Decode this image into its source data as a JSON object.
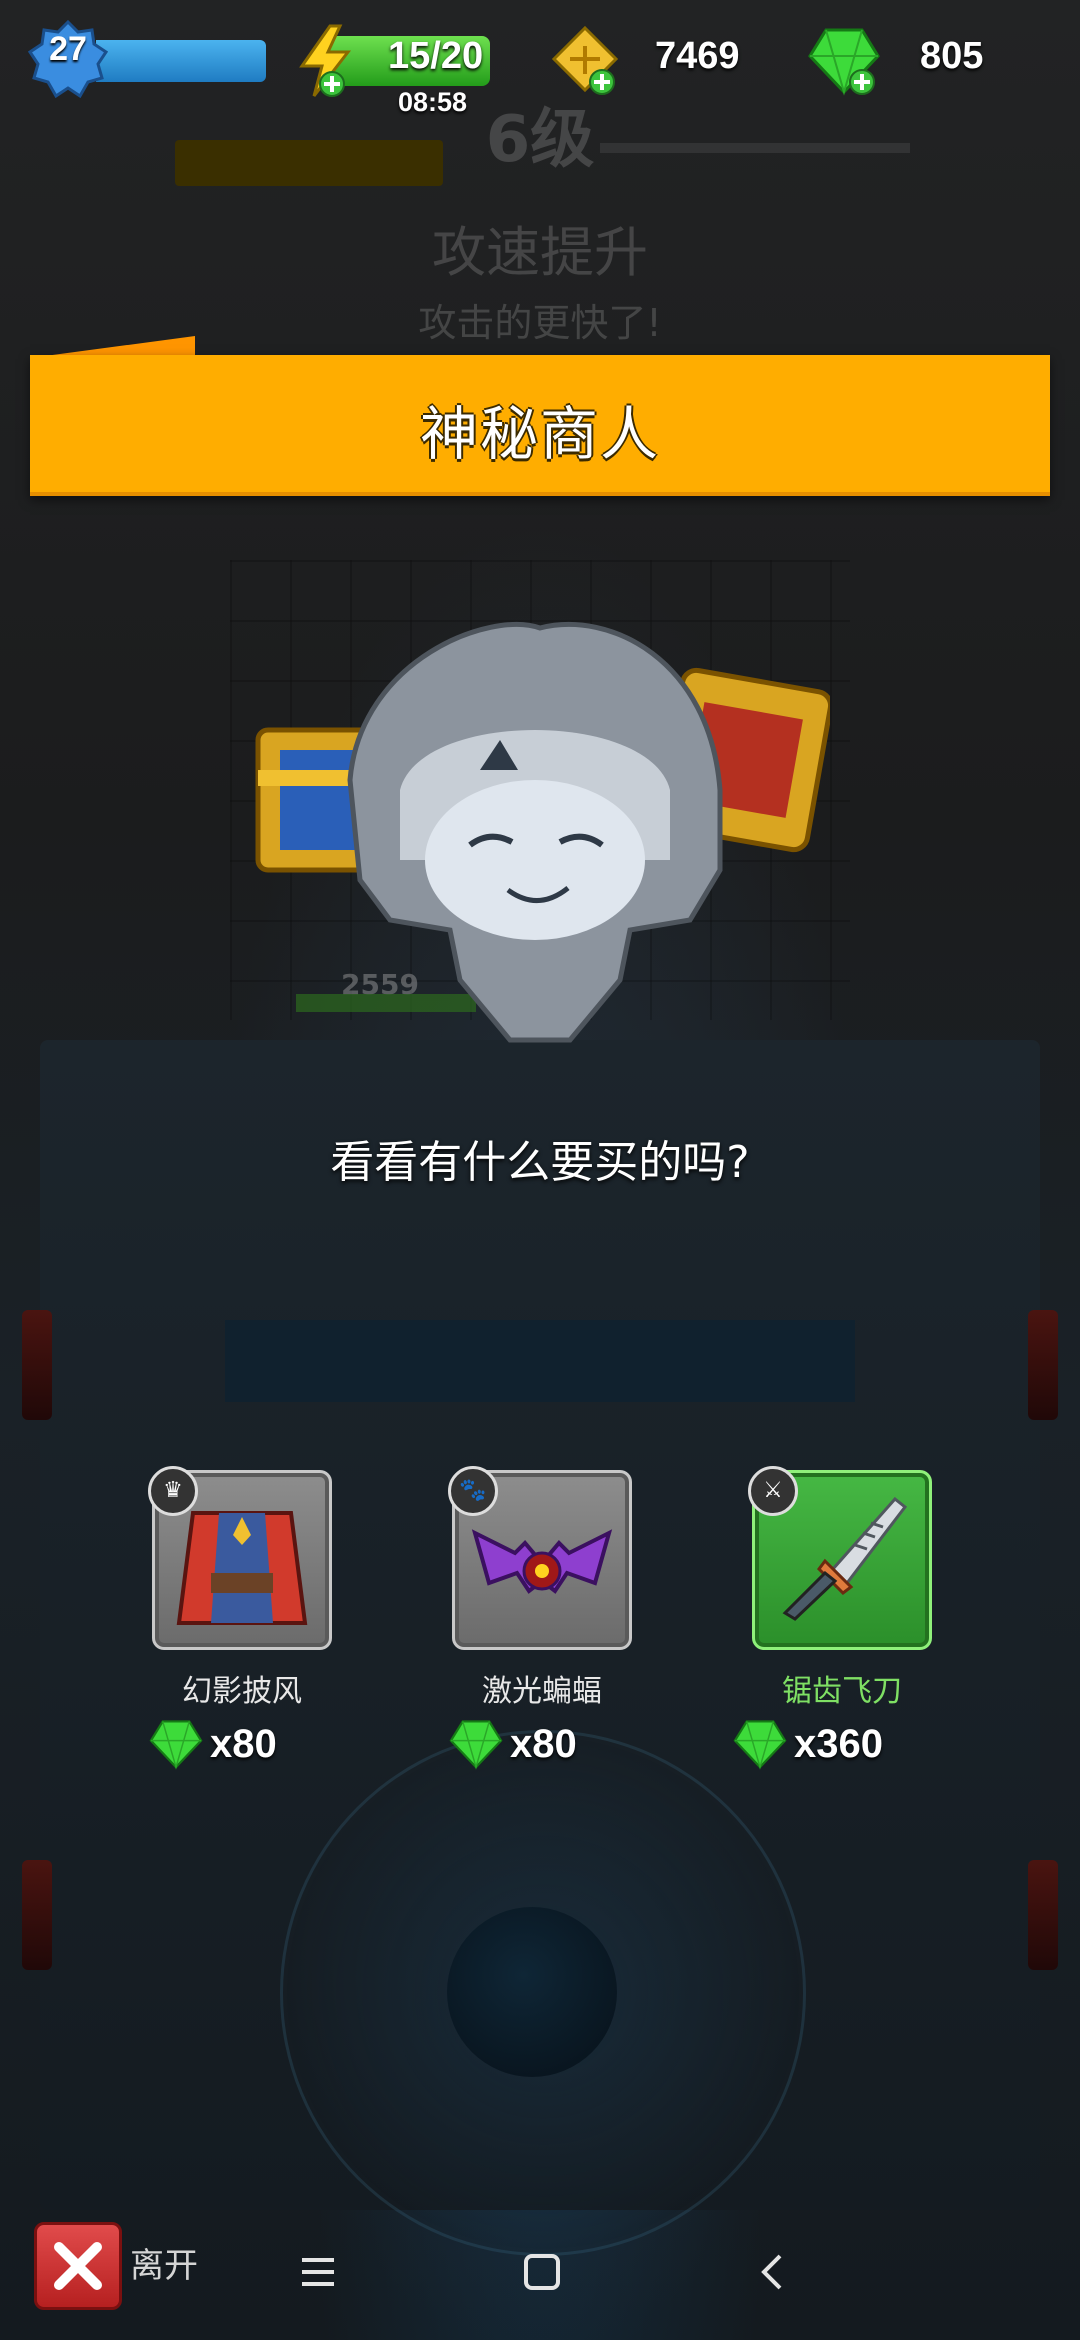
{
  "hud": {
    "level": "27",
    "energy": "15/20",
    "energy_timer": "08:58",
    "gold": "7469",
    "gems": "805"
  },
  "background": {
    "level_text": "6级",
    "skill_title": "攻速提升",
    "skill_desc": "攻击的更快了!",
    "hp_value": "2559"
  },
  "dialog": {
    "title": "神秘商人",
    "prompt": "看看有什么要买的吗?"
  },
  "shop": {
    "items": [
      {
        "name": "幻影披风",
        "price": "x80",
        "icon": "cloak-icon",
        "type_icon": "armor-slot-icon"
      },
      {
        "name": "激光蝙蝠",
        "price": "x80",
        "icon": "bat-icon",
        "type_icon": "pet-slot-icon"
      },
      {
        "name": "锯齿飞刀",
        "price": "x360",
        "icon": "sword-icon",
        "type_icon": "weapon-slot-icon"
      }
    ]
  },
  "bottom": {
    "leave_label": "离开"
  },
  "colors": {
    "banner": "#ffad00",
    "gem": "#3ddb3a",
    "leave": "#d23232"
  }
}
